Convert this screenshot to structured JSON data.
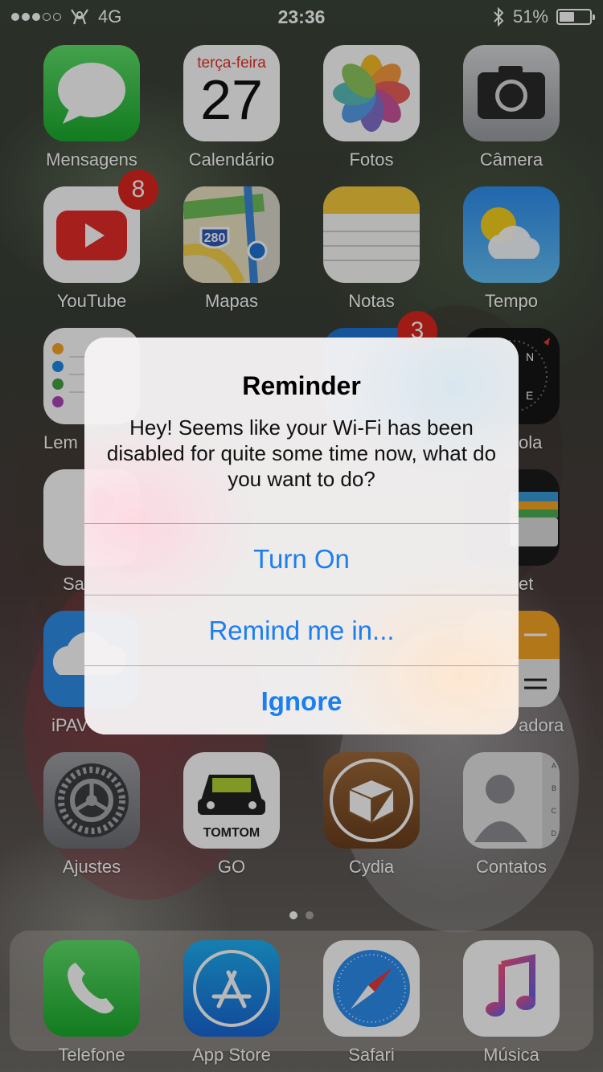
{
  "status_bar": {
    "carrier_icon": "pokemon-go-icon",
    "network": "4G",
    "time": "23:36",
    "bluetooth_icon": "bluetooth-icon",
    "battery_percent": "51%",
    "battery_level": 0.51
  },
  "apps": [
    {
      "label": "Mensagens",
      "icon": "messages-icon"
    },
    {
      "label": "Calendário",
      "icon": "calendar-icon",
      "day_name": "terça-feira",
      "day_number": "27"
    },
    {
      "label": "Fotos",
      "icon": "photos-icon"
    },
    {
      "label": "Câmera",
      "icon": "camera-icon"
    },
    {
      "label": "YouTube",
      "icon": "youtube-icon",
      "badge": "8"
    },
    {
      "label": "Mapas",
      "icon": "maps-icon",
      "road_sign": "280"
    },
    {
      "label": "Notas",
      "icon": "notes-icon"
    },
    {
      "label": "Tempo",
      "icon": "weather-icon"
    },
    {
      "label": "Lem",
      "icon": "reminders-icon"
    },
    {
      "label": "",
      "icon": "app-icon",
      "badge": "3"
    },
    {
      "label": "ola",
      "icon": "compass-icon",
      "compass_n": "N",
      "compass_e": "E"
    },
    {
      "label": "Sa",
      "icon": "health-icon"
    },
    {
      "label": "et",
      "icon": "wallet-icon"
    },
    {
      "label": "iPAV",
      "icon": "download-icon"
    },
    {
      "label": "adora",
      "icon": "calculator-icon"
    },
    {
      "label": "Ajustes",
      "icon": "settings-icon"
    },
    {
      "label": "GO",
      "icon": "tomtom-icon",
      "brand": "TOMTOM"
    },
    {
      "label": "Cydia",
      "icon": "cydia-icon"
    },
    {
      "label": "Contatos",
      "icon": "contacts-icon",
      "tabs": [
        "A",
        "B",
        "C",
        "D"
      ]
    }
  ],
  "dock": [
    {
      "label": "Telefone",
      "icon": "phone-icon"
    },
    {
      "label": "App Store",
      "icon": "app-store-icon"
    },
    {
      "label": "Safari",
      "icon": "safari-icon"
    },
    {
      "label": "Música",
      "icon": "music-icon"
    }
  ],
  "alert": {
    "title": "Reminder",
    "message": "Hey! Seems like your Wi-Fi has been disabled for quite some time now, what do you want to do?",
    "buttons": [
      "Turn On",
      "Remind me in...",
      "Ignore"
    ]
  },
  "colors": {
    "ios_blue": "#1b7ff0",
    "badge_red": "#e0261f"
  }
}
